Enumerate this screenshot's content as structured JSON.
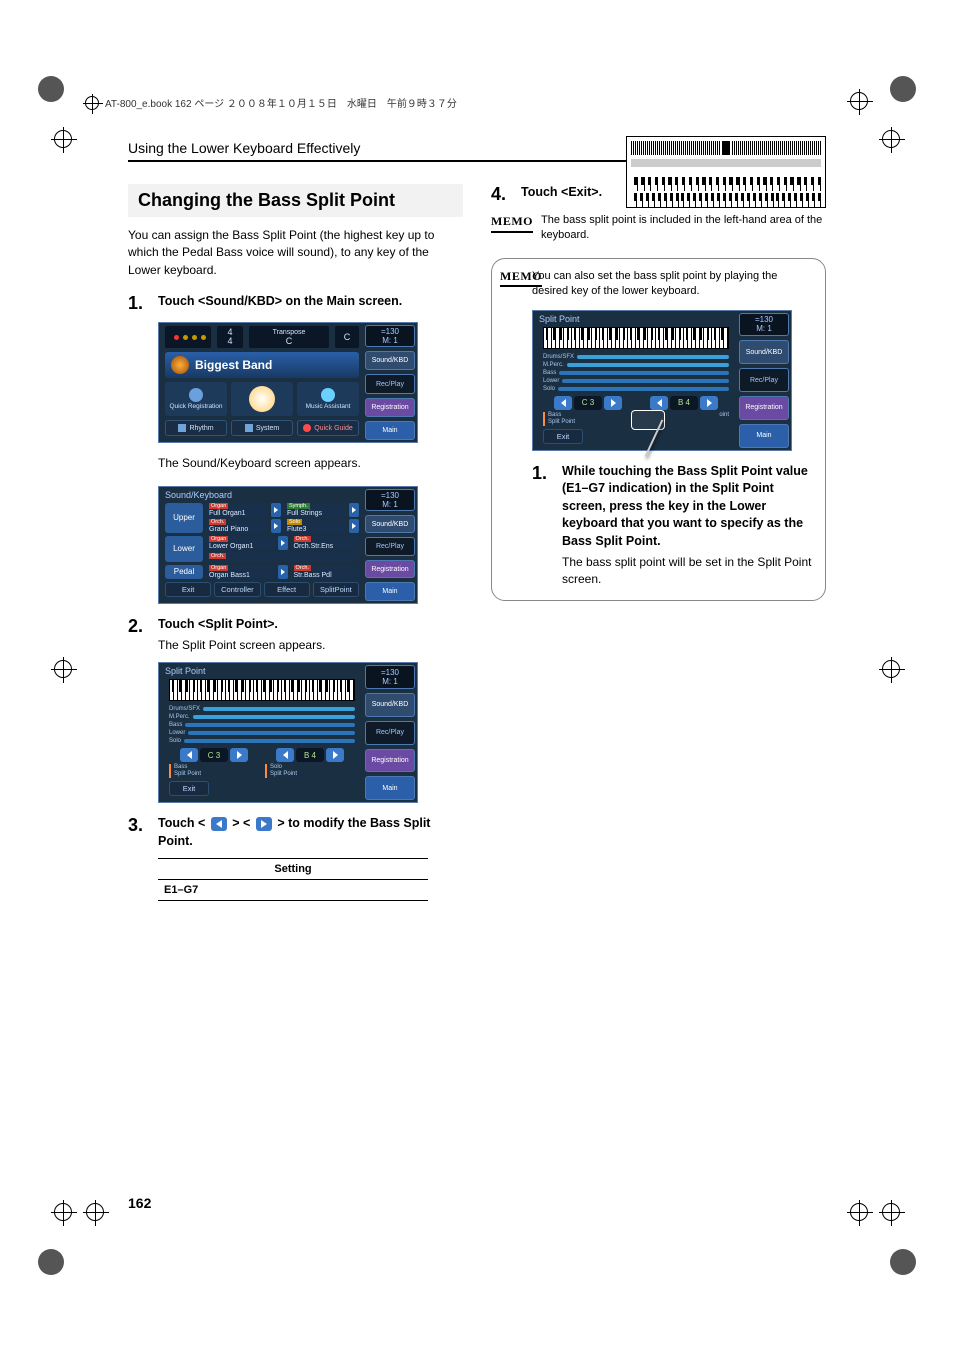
{
  "header_filename": "AT-800_e.book  162 ページ  ２００８年１０月１５日　水曜日　午前９時３７分",
  "running_head": "Using the Lower Keyboard Effectively",
  "section_title": "Changing the Bass Split Point",
  "intro": "You can assign the Bass Split Point (the highest key up to which the Pedal Bass voice will sound), to any key of the Lower keyboard.",
  "steps": {
    "s1": {
      "num": "1.",
      "head": "Touch <Sound/KBD> on the Main screen.",
      "after": "The Sound/Keyboard screen appears."
    },
    "s2": {
      "num": "2.",
      "head": "Touch <Split Point>.",
      "after": "The Split Point screen appears."
    },
    "s3": {
      "num": "3.",
      "head_pre": "Touch < ",
      "head_mid": " > < ",
      "head_post": " > to modify the Bass Split Point."
    },
    "s4": {
      "num": "4.",
      "head": "Touch <Exit>."
    }
  },
  "setting_table": {
    "header": "Setting",
    "value": "E1–G7"
  },
  "memo_label": "MEMO",
  "memo1_text": "The bass split point is included in the left-hand area of the keyboard.",
  "memo2_text": "You can also set the bass split point by playing the desired key of the lower keyboard.",
  "memo2_step": {
    "num": "1.",
    "head": "While touching the Bass Split Point value (E1–G7 indication) in the Split Point screen, press the key in the Lower keyboard that you want to specify as the Bass Split Point.",
    "after": "The bass split point will be set in the Split Point screen."
  },
  "page_number": "162",
  "screens": {
    "tempo": {
      "bpm": "=130",
      "meas": "M:    1"
    },
    "side": {
      "soundkbd": "Sound/KBD",
      "recplay": "Rec/Play",
      "registration": "Registration",
      "main": "Main"
    },
    "main": {
      "timesig": "4\n4",
      "transpose_label": "Transpose",
      "transpose_val": "C",
      "zone": "C",
      "band": "Biggest Band",
      "row3": {
        "a": "Quick Registration",
        "b": "",
        "c": "Music Assistant"
      },
      "row4": {
        "rhythm": "Rhythm",
        "system": "System",
        "quick": "Quick Guide"
      }
    },
    "soundkbd": {
      "title": "Sound/Keyboard",
      "parts": {
        "upper": "Upper",
        "lower": "Lower",
        "pedal": "Pedal"
      },
      "cats": {
        "organ": "Organ",
        "orch": "Orch.",
        "symph": "Symph.",
        "solo": "Solo"
      },
      "voices": {
        "u1": "Full Organ1",
        "u2": "Full Strings",
        "u3": "Grand Piano",
        "u4": "Flute3",
        "l1": "Lower Organ1",
        "l2": "Orch.Str.Ens",
        "p1": "Organ Bass1",
        "p2": "Str.Bass Pdl"
      },
      "bottom": {
        "exit": "Exit",
        "controller": "Controller",
        "effect": "Effect",
        "split": "SplitPoint"
      }
    },
    "split": {
      "title": "Split Point",
      "lanes": [
        "Drums/SFX",
        "M.Perc.",
        "Bass",
        "Lower",
        "Solo"
      ],
      "bass_val": "C 3",
      "solo_val": "B 4",
      "bass_cap": "Bass\nSplit Point",
      "solo_cap": "Solo\nSplit Point",
      "exit": "Exit",
      "memo_touch": "oint"
    }
  },
  "colors": {
    "lane": [
      "#3aa0d8",
      "#3aa0d8",
      "#2c74b8",
      "#2c74b8",
      "#2c74b8"
    ]
  }
}
